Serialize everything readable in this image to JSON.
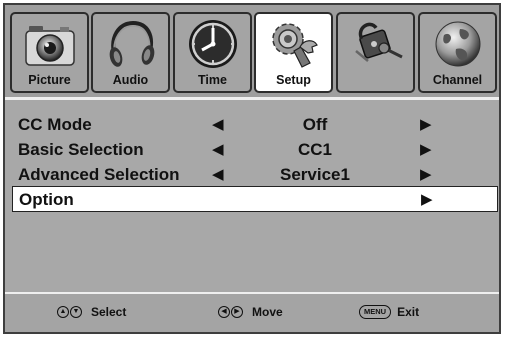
{
  "tabs": [
    {
      "label": "Picture",
      "icon": "camera-icon",
      "active": false
    },
    {
      "label": "Audio",
      "icon": "headphones-icon",
      "active": false
    },
    {
      "label": "Time",
      "icon": "clock-icon",
      "active": false
    },
    {
      "label": "Setup",
      "icon": "gear-wrench-icon",
      "active": true
    },
    {
      "label": "",
      "icon": "lock-key-icon",
      "active": false
    },
    {
      "label": "Channel",
      "icon": "globe-icon",
      "active": false
    }
  ],
  "menu": {
    "rows": [
      {
        "name": "CC Mode",
        "value": "Off",
        "prev": "◀",
        "next": "▶"
      },
      {
        "name": "Basic Selection",
        "value": "CC1",
        "prev": "◀",
        "next": "▶"
      },
      {
        "name": "Advanced Selection",
        "value": "Service1",
        "prev": "◀",
        "next": "▶"
      },
      {
        "name": "Option",
        "value": "",
        "prev": "",
        "next": "▶",
        "selected": true
      }
    ]
  },
  "footer": {
    "select": {
      "glyphs": [
        "▲",
        "▼"
      ],
      "label": "Select"
    },
    "move": {
      "glyphs": [
        "◀",
        "▶"
      ],
      "label": "Move"
    },
    "exit": {
      "key": "MENU",
      "label": "Exit"
    }
  },
  "colors": {
    "background": "#a8a8a8",
    "tab_active": "#ffffff",
    "selected_row": "#ffffff"
  }
}
